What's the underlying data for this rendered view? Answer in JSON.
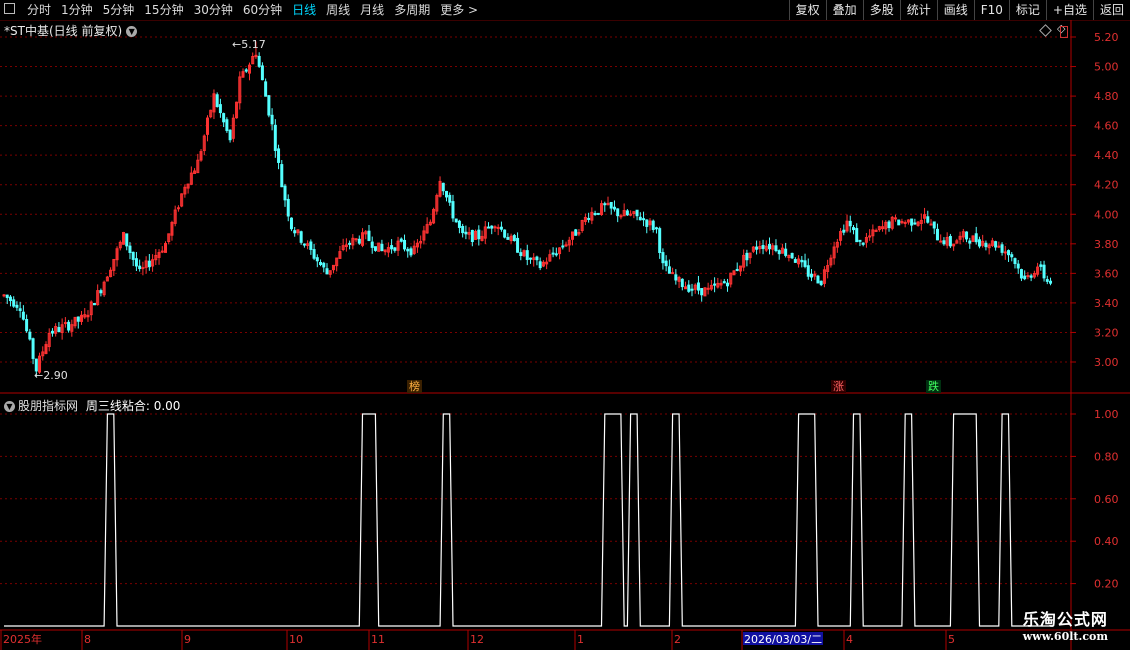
{
  "toolbar": {
    "periods": [
      "分时",
      "1分钟",
      "5分钟",
      "15分钟",
      "30分钟",
      "60分钟",
      "日线",
      "周线",
      "月线",
      "多周期",
      "更多 >"
    ],
    "active_period": "日线",
    "tools": [
      "复权",
      "叠加",
      "多股",
      "统计",
      "画线",
      "F10",
      "标记",
      "+自选",
      "返回"
    ]
  },
  "stock": {
    "title": "*ST中基(日线 前复权)"
  },
  "indicator": {
    "title": "股朋指标网",
    "label": "周三线粘合: 0.00"
  },
  "annotations": {
    "high_label": "5.17",
    "low_label": "2.90"
  },
  "badges": [
    {
      "text": "榜",
      "color": "#ffb040",
      "bg": "#3a2000"
    },
    {
      "text": "涨",
      "color": "#ff6060",
      "bg": "#300000"
    },
    {
      "text": "跌",
      "color": "#40ff60",
      "bg": "#003010"
    }
  ],
  "axis": {
    "price_ticks": [
      "5.20",
      "5.00",
      "4.80",
      "4.60",
      "4.40",
      "4.20",
      "4.00",
      "3.80",
      "3.60",
      "3.40",
      "3.20",
      "3.00"
    ],
    "indicator_ticks": [
      "1.00",
      "0.80",
      "0.60",
      "0.40",
      "0.20"
    ],
    "date_labels": [
      "2025年",
      "8",
      "9",
      "10",
      "11",
      "12",
      "1",
      "2",
      "2026/03/03/二",
      "4",
      "5"
    ]
  },
  "colors": {
    "up": "#ff3232",
    "down": "#54ffff",
    "grid": "#7a0000",
    "axis": "#b00000",
    "signal": "#ffffff"
  },
  "watermark": {
    "line1": "乐淘公式网",
    "line2": "www.60lt.com"
  },
  "chart_data": {
    "type": "candlestick",
    "price_range": [
      2.85,
      5.25
    ],
    "anchors": [
      [
        0,
        3.45
      ],
      [
        5,
        3.38
      ],
      [
        10,
        2.95
      ],
      [
        14,
        3.2
      ],
      [
        20,
        3.25
      ],
      [
        25,
        3.3
      ],
      [
        30,
        3.5
      ],
      [
        37,
        3.85
      ],
      [
        42,
        3.6
      ],
      [
        50,
        3.8
      ],
      [
        56,
        4.2
      ],
      [
        60,
        4.35
      ],
      [
        65,
        4.8
      ],
      [
        70,
        4.5
      ],
      [
        73,
        4.9
      ],
      [
        78,
        5.1
      ],
      [
        83,
        4.6
      ],
      [
        86,
        4.2
      ],
      [
        89,
        3.92
      ],
      [
        95,
        3.75
      ],
      [
        100,
        3.6
      ],
      [
        106,
        3.8
      ],
      [
        112,
        3.85
      ],
      [
        117,
        3.75
      ],
      [
        122,
        3.8
      ],
      [
        127,
        3.75
      ],
      [
        132,
        3.95
      ],
      [
        135,
        4.25
      ],
      [
        138,
        4.05
      ],
      [
        142,
        3.85
      ],
      [
        147,
        3.85
      ],
      [
        152,
        3.95
      ],
      [
        157,
        3.82
      ],
      [
        162,
        3.7
      ],
      [
        166,
        3.65
      ],
      [
        171,
        3.75
      ],
      [
        176,
        3.85
      ],
      [
        181,
        4.0
      ],
      [
        186,
        4.05
      ],
      [
        191,
        4.0
      ],
      [
        197,
        3.98
      ],
      [
        202,
        3.9
      ],
      [
        204,
        3.65
      ],
      [
        208,
        3.55
      ],
      [
        213,
        3.5
      ],
      [
        218,
        3.48
      ],
      [
        224,
        3.55
      ],
      [
        229,
        3.7
      ],
      [
        234,
        3.8
      ],
      [
        239,
        3.78
      ],
      [
        244,
        3.72
      ],
      [
        249,
        3.6
      ],
      [
        253,
        3.55
      ],
      [
        257,
        3.8
      ],
      [
        261,
        3.95
      ],
      [
        265,
        3.8
      ],
      [
        270,
        3.88
      ],
      [
        275,
        3.95
      ],
      [
        280,
        3.95
      ],
      [
        285,
        3.98
      ],
      [
        289,
        3.85
      ],
      [
        293,
        3.8
      ],
      [
        297,
        3.85
      ],
      [
        302,
        3.82
      ],
      [
        307,
        3.8
      ],
      [
        312,
        3.72
      ],
      [
        316,
        3.55
      ],
      [
        320,
        3.65
      ],
      [
        323,
        3.55
      ]
    ],
    "peak": {
      "index": 78,
      "value": 5.17
    },
    "trough": {
      "index": 10,
      "value": 2.9
    },
    "signal_range": [
      0,
      1
    ],
    "pulse_centers": [
      33,
      112,
      114,
      137,
      187,
      190,
      195,
      208,
      247,
      250,
      264,
      280,
      295,
      297,
      300,
      310
    ]
  }
}
